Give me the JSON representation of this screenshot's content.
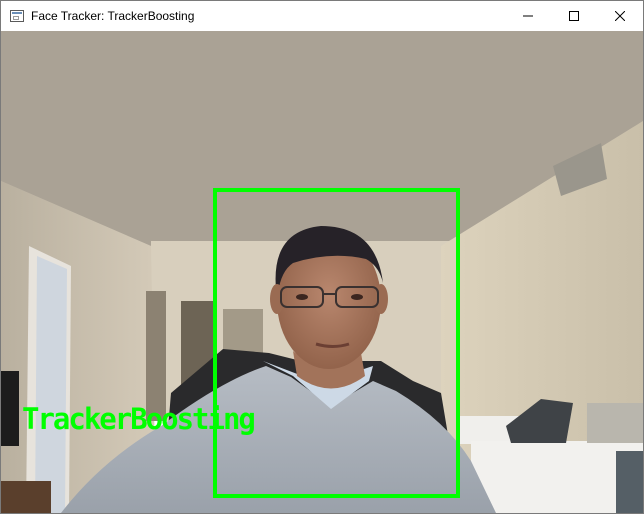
{
  "window": {
    "title": "Face Tracker: TrackerBoosting",
    "icon": "app-window-icon",
    "controls": {
      "minimize_icon": "minimize-icon",
      "maximize_icon": "maximize-icon",
      "close_icon": "close-icon"
    }
  },
  "video": {
    "tracker_label": "TrackerBoosting",
    "overlay_color": "#00ff00"
  }
}
